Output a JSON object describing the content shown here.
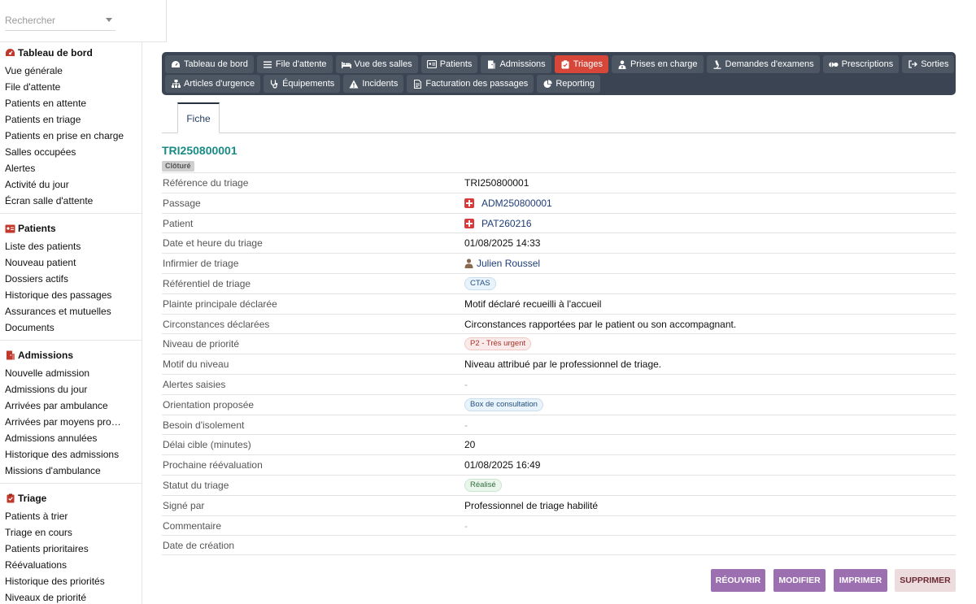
{
  "search": {
    "placeholder": "Rechercher"
  },
  "sidebar": {
    "sections": [
      {
        "title": "Tableau de bord",
        "icon": "dashboard-icon",
        "items": [
          "Vue générale",
          "File d'attente",
          "Patients en attente",
          "Patients en triage",
          "Patients en prise en charge",
          "Salles occupées",
          "Alertes",
          "Activité du jour",
          "Écran salle d'attente"
        ]
      },
      {
        "title": "Patients",
        "icon": "id-card-icon",
        "items": [
          "Liste des patients",
          "Nouveau patient",
          "Dossiers actifs",
          "Historique des passages",
          "Assurances et mutuelles",
          "Documents"
        ]
      },
      {
        "title": "Admissions",
        "icon": "door-icon",
        "items": [
          "Nouvelle admission",
          "Admissions du jour",
          "Arrivées par ambulance",
          "Arrivées par moyens pro…",
          "Admissions annulées",
          "Historique des admissions",
          "Missions d'ambulance"
        ]
      },
      {
        "title": "Triage",
        "icon": "clipboard-icon",
        "items": [
          "Patients à trier",
          "Triage en cours",
          "Patients prioritaires",
          "Réévaluations",
          "Historique des priorités",
          "Niveaux de priorité"
        ]
      }
    ]
  },
  "topmenu": {
    "row1": [
      {
        "label": "Tableau de bord",
        "icon": "dashboard-icon"
      },
      {
        "label": "File d'attente",
        "icon": "list-icon"
      },
      {
        "label": "Vue des salles",
        "icon": "bed-icon"
      },
      {
        "label": "Patients",
        "icon": "id-card-icon"
      },
      {
        "label": "Admissions",
        "icon": "door-icon"
      },
      {
        "label": "Triages",
        "icon": "clipboard-icon",
        "active": true
      },
      {
        "label": "Prises en charge",
        "icon": "user-doctor-icon"
      },
      {
        "label": "Demandes d'examens",
        "icon": "microscope-icon"
      },
      {
        "label": "Prescriptions",
        "icon": "pills-icon"
      },
      {
        "label": "Sorties",
        "icon": "exit-icon"
      }
    ],
    "row2": [
      {
        "label": "Articles d'urgence",
        "icon": "sitemap-icon"
      },
      {
        "label": "Équipements",
        "icon": "stethoscope-icon"
      },
      {
        "label": "Incidents",
        "icon": "warning-icon"
      },
      {
        "label": "Facturation des passages",
        "icon": "invoice-icon"
      },
      {
        "label": "Reporting",
        "icon": "pie-chart-icon"
      }
    ]
  },
  "tabs": {
    "fiche": "Fiche"
  },
  "record": {
    "title": "TRI250800001",
    "status": "Clôturé"
  },
  "fields": {
    "reference": {
      "label": "Référence du triage",
      "value": "TRI250800001"
    },
    "passage": {
      "label": "Passage",
      "value": "ADM250800001"
    },
    "patient": {
      "label": "Patient",
      "value": "PAT260216"
    },
    "date": {
      "label": "Date et heure du triage",
      "value": "01/08/2025 14:33"
    },
    "nurse": {
      "label": "Infirmier de triage",
      "value": "Julien Roussel"
    },
    "referential": {
      "label": "Référentiel de triage",
      "value": "CTAS"
    },
    "complaint": {
      "label": "Plainte principale déclarée",
      "value": "Motif déclaré recueilli à l'accueil"
    },
    "circumstances": {
      "label": "Circonstances déclarées",
      "value": "Circonstances rapportées par le patient ou son accompagnant."
    },
    "priority": {
      "label": "Niveau de priorité",
      "value": "P2 - Très urgent"
    },
    "level_reason": {
      "label": "Motif du niveau",
      "value": "Niveau attribué par le professionnel de triage."
    },
    "alerts": {
      "label": "Alertes saisies",
      "value": "-"
    },
    "orientation": {
      "label": "Orientation proposée",
      "value": "Box de consultation"
    },
    "isolation": {
      "label": "Besoin d'isolement",
      "value": "-"
    },
    "target_delay": {
      "label": "Délai cible (minutes)",
      "value": "20"
    },
    "next_reeval": {
      "label": "Prochaine réévaluation",
      "value": "01/08/2025 16:49"
    },
    "triage_status": {
      "label": "Statut du triage",
      "value": "Réalisé"
    },
    "signed_by": {
      "label": "Signé par",
      "value": "Professionnel de triage habilité"
    },
    "comment": {
      "label": "Commentaire",
      "value": "-"
    },
    "created": {
      "label": "Date de création",
      "value": ""
    }
  },
  "actions": {
    "reopen": "RÉOUVRIR",
    "edit": "MODIFIER",
    "print": "IMPRIMER",
    "delete": "SUPPRIMER"
  },
  "colors": {
    "menu_bg": "#3a4452",
    "menu_active": "#d6473a",
    "title_teal": "#1a8b84",
    "action_purple": "#9b6fb0",
    "delete_bg": "#ecdcde"
  }
}
